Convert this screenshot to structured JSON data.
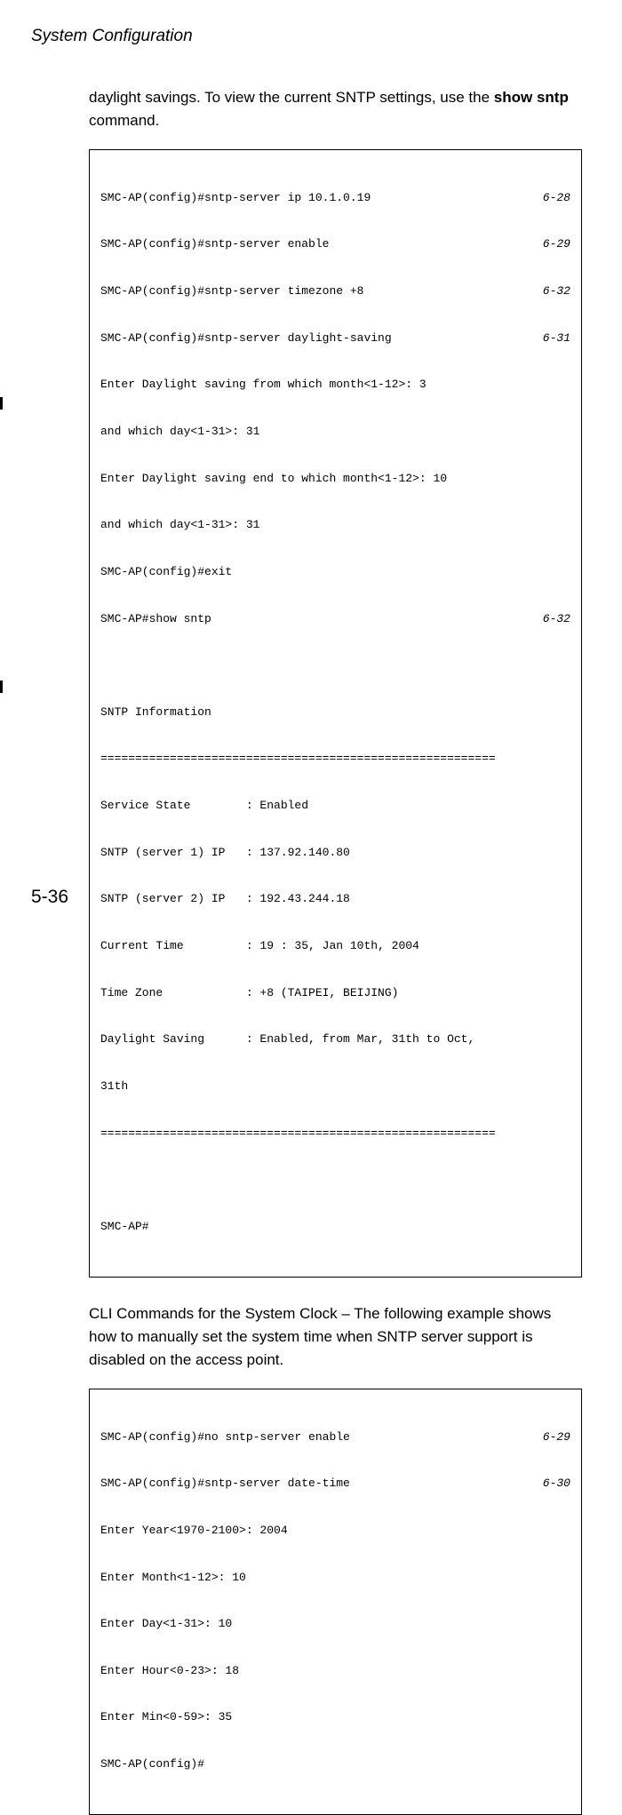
{
  "header": "System Configuration",
  "para1_a": "daylight savings. To view the current SNTP settings, use the ",
  "para1_b": "show sntp",
  "para1_c": " command.",
  "code1": {
    "l1": {
      "text": "SMC-AP(config)#sntp-server ip 10.1.0.19",
      "ref": "6-28"
    },
    "l2": {
      "text": "SMC-AP(config)#sntp-server enable",
      "ref": "6-29"
    },
    "l3": {
      "text": "SMC-AP(config)#sntp-server timezone +8",
      "ref": "6-32"
    },
    "l4": {
      "text": "SMC-AP(config)#sntp-server daylight-saving",
      "ref": "6-31"
    },
    "l5": "Enter Daylight saving from which month<1-12>: 3",
    "l6": "and which day<1-31>: 31",
    "l7": "Enter Daylight saving end to which month<1-12>: 10",
    "l8": "and which day<1-31>: 31",
    "l9": "SMC-AP(config)#exit",
    "l10": {
      "text": "SMC-AP#show sntp",
      "ref": "6-32"
    },
    "l11": " ",
    "l12": "SNTP Information",
    "l13": "=========================================================",
    "l14": "Service State        : Enabled",
    "l15": "SNTP (server 1) IP   : 137.92.140.80",
    "l16": "SNTP (server 2) IP   : 192.43.244.18",
    "l17": "Current Time         : 19 : 35, Jan 10th, 2004",
    "l18": "Time Zone            : +8 (TAIPEI, BEIJING)",
    "l19": "Daylight Saving      : Enabled, from Mar, 31th to Oct, ",
    "l20": "31th",
    "l21": "=========================================================",
    "l22": " ",
    "l23": "SMC-AP#"
  },
  "para2": "CLI Commands for the System Clock – The following example shows how to manually set the system time when SNTP server support is disabled on the access point.",
  "code2": {
    "l1": {
      "text": "SMC-AP(config)#no sntp-server enable",
      "ref": "6-29"
    },
    "l2": {
      "text": "SMC-AP(config)#sntp-server date-time",
      "ref": "6-30"
    },
    "l3": "Enter Year<1970-2100>: 2004",
    "l4": "Enter Month<1-12>: 10",
    "l5": "Enter Day<1-31>: 10",
    "l6": "Enter Hour<0-23>: 18",
    "l7": "Enter Min<0-59>: 35",
    "l8": "SMC-AP(config)#"
  },
  "pageNumber": "5-36"
}
